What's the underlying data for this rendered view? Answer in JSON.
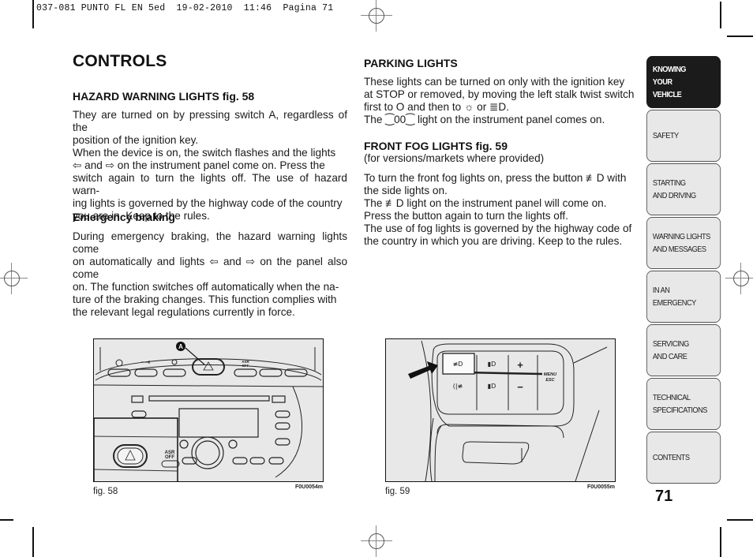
{
  "print_header": "037-081 PUNTO FL EN 5ed  19-02-2010  11:46  Pagina 71",
  "page": {
    "title": "CONTROLS",
    "page_number": "71"
  },
  "left_column": {
    "hazard_heading": "HAZARD WARNING LIGHTS fig. 58",
    "hazard_text": "They are turned on by pressing switch A, regardless of the position of the ignition key. When the device is on, the switch flashes and the lights ⇦ and ⇨ on the instrument panel come on. Press the switch again to turn the lights off. The use of hazard warning lights is governed by the highway code of the country you are in. Keep to the rules.",
    "hazard_lines": [
      "They are turned on by pressing switch A, regardless of the",
      "position of the ignition key.",
      "When the device is on, the switch flashes and the lights",
      "⇦ and ⇨ on the instrument panel come on. Press the",
      "switch again to turn the lights off. The use of hazard warn-",
      "ing lights is governed by the highway code of the country",
      "you are in. Keep to the rules."
    ],
    "braking_heading": "Emergency braking",
    "braking_lines": [
      "During emergency braking, the hazard warning lights come",
      "on automatically and lights ⇦ and ⇨ on the panel also come",
      "on. The function switches off automatically when the na-",
      "ture of the braking changes. This function complies with",
      "the relevant legal regulations currently in force."
    ]
  },
  "right_column": {
    "parking_heading": "PARKING LIGHTS",
    "parking_lines": [
      "These lights can be turned on only with the ignition key",
      "at STOP or removed, by moving the left stalk twist switch",
      "first to O and then to ☼ or ≣D.",
      "The ⁐00⁐ light on the instrument panel comes on."
    ],
    "fog_heading": "FRONT FOG LIGHTS fig. 59",
    "fog_subheading": "(for versions/markets where provided)",
    "fog_lines": [
      "To turn the front fog lights on, press the button ≢D with",
      "the side lights on.",
      "The ≢D light on the instrument panel will come on.",
      "Press the button again to turn the lights off.",
      "The use of fog lights is governed by the highway code of",
      "the country in which you are driving.  Keep to the rules."
    ]
  },
  "figures": [
    {
      "caption": "fig. 58",
      "code": "F0U0054m",
      "callout": "A",
      "button_labels": {
        "asr_top": "ASR",
        "asr_bottom": "OFF"
      },
      "icons": [
        "steering-wheel-icon",
        "key-icon",
        "no-parking-icon",
        "hazard-triangle-icon"
      ]
    },
    {
      "caption": "fig. 59",
      "code": "F0U0055m",
      "button_labels": {
        "menu": "MENU",
        "esc": "ESC",
        "plus": "+",
        "minus": "−"
      },
      "icons": [
        "front-fog-light-icon",
        "low-beam-icon",
        "rear-fog-light-icon",
        "headlamp-adjust-icon",
        "arrow-pointer-icon"
      ]
    }
  ],
  "section_tabs": [
    {
      "label": "KNOWING\nYOUR\nVEHICLE",
      "active": true
    },
    {
      "label": "SAFETY",
      "active": false
    },
    {
      "label": "STARTING\nAND DRIVING",
      "active": false
    },
    {
      "label": "WARNING LIGHTS\nAND MESSAGES",
      "active": false
    },
    {
      "label": "IN AN\nEMERGENCY",
      "active": false
    },
    {
      "label": "SERVICING\nAND CARE",
      "active": false
    },
    {
      "label": "TECHNICAL\nSPECIFICATIONS",
      "active": false
    },
    {
      "label": "CONTENTS",
      "active": false
    }
  ]
}
